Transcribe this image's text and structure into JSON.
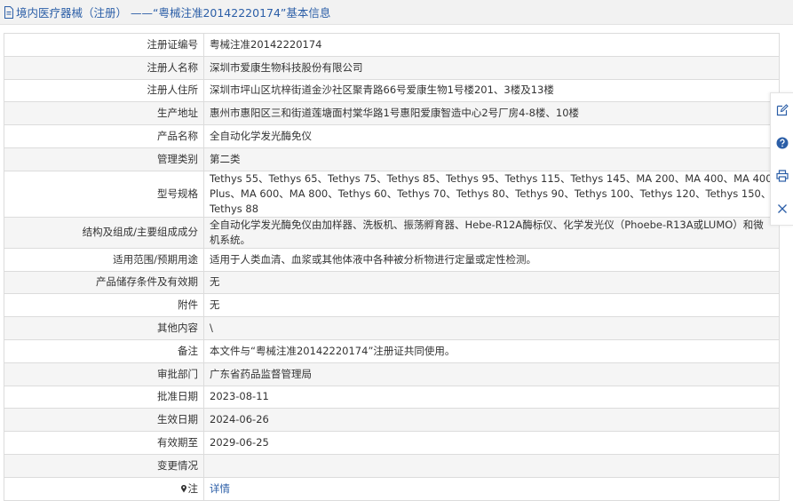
{
  "header": {
    "title": "境内医疗器械（注册）  ——“粤械注准20142220174”基本信息"
  },
  "rows": [
    {
      "label": "注册证编号",
      "value": "粤械注准20142220174"
    },
    {
      "label": "注册人名称",
      "value": "深圳市爱康生物科技股份有限公司"
    },
    {
      "label": "注册人住所",
      "value": "深圳市坪山区坑梓街道金沙社区聚青路66号爱康生物1号楼201、3楼及13楼"
    },
    {
      "label": "生产地址",
      "value": "惠州市惠阳区三和街道莲塘面村棠华路1号惠阳爱康智造中心2号厂房4-8楼、10楼"
    },
    {
      "label": "产品名称",
      "value": "全自动化学发光酶免仪"
    },
    {
      "label": "管理类别",
      "value": "第二类"
    },
    {
      "label": "型号规格",
      "value": "Tethys 55、Tethys 65、Tethys 75、Tethys 85、Tethys 95、Tethys 115、Tethys 145、MA 200、MA 400、MA 400 Plus、MA 600、MA 800、Tethys 60、Tethys 70、Tethys 80、Tethys 90、Tethys 100、Tethys 120、Tethys 150、Tethys 88"
    },
    {
      "label": "结构及组成/主要组成成分",
      "value": "全自动化学发光酶免仪由加样器、洗板机、振荡孵育器、Hebe-R12A酶标仪、化学发光仪（Phoebe-R13A或LUMO）和微机系统。"
    },
    {
      "label": "适用范围/预期用途",
      "value": "适用于人类血清、血浆或其他体液中各种被分析物进行定量或定性检测。"
    },
    {
      "label": "产品储存条件及有效期",
      "value": "无"
    },
    {
      "label": "附件",
      "value": "无"
    },
    {
      "label": "其他内容",
      "value": "\\"
    },
    {
      "label": "备注",
      "value": "本文件与“粤械注准20142220174”注册证共同使用。"
    },
    {
      "label": "审批部门",
      "value": "广东省药品监督管理局"
    },
    {
      "label": "批准日期",
      "value": "2023-08-11"
    },
    {
      "label": "生效日期",
      "value": "2024-06-26"
    },
    {
      "label": "有效期至",
      "value": "2029-06-25"
    },
    {
      "label": "变更情况",
      "value": ""
    },
    {
      "label": "注",
      "value": "详情"
    }
  ],
  "colors": {
    "accent": "#2b5ea7",
    "alt_row": "#f5f5f5",
    "border": "#dcdcdc"
  },
  "icons": [
    "document-icon",
    "pin-icon",
    "edit-icon",
    "help-icon",
    "print-icon",
    "close-icon"
  ]
}
